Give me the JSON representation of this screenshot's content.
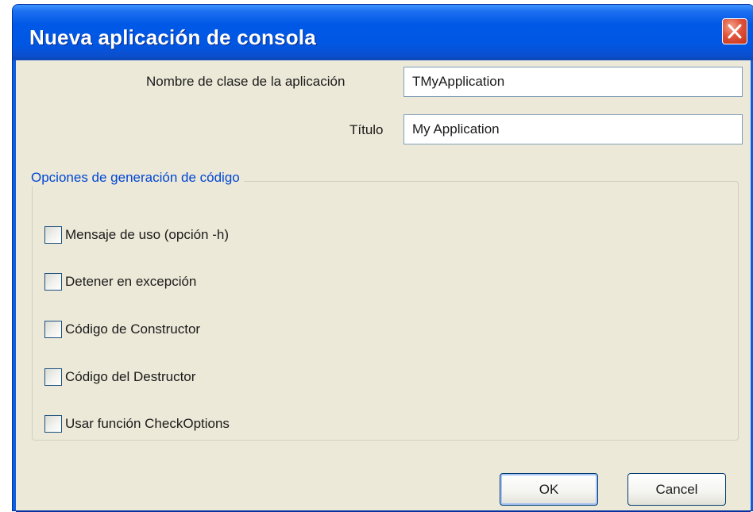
{
  "window": {
    "title": "Nueva aplicación de consola"
  },
  "form": {
    "class_name_label": "Nombre de clase de la aplicación",
    "class_name_value": "TMyApplication",
    "title_label": "Título",
    "title_value": "My Application"
  },
  "options": {
    "group_title": "Opciones de generación de código",
    "items": [
      {
        "label": "Mensaje de uso (opción -h)",
        "checked": false
      },
      {
        "label": "Detener en excepción",
        "checked": false
      },
      {
        "label": "Código de Constructor",
        "checked": false
      },
      {
        "label": "Código del Destructor",
        "checked": false
      },
      {
        "label": "Usar función CheckOptions",
        "checked": false
      }
    ]
  },
  "buttons": {
    "ok_label": "OK",
    "cancel_label": "Cancel"
  },
  "colors": {
    "titlebar": "#0058e6",
    "client_background": "#ece9d8",
    "group_title": "#0046d5",
    "close_button": "#e0533a"
  },
  "icons": {
    "close": "close-icon"
  }
}
